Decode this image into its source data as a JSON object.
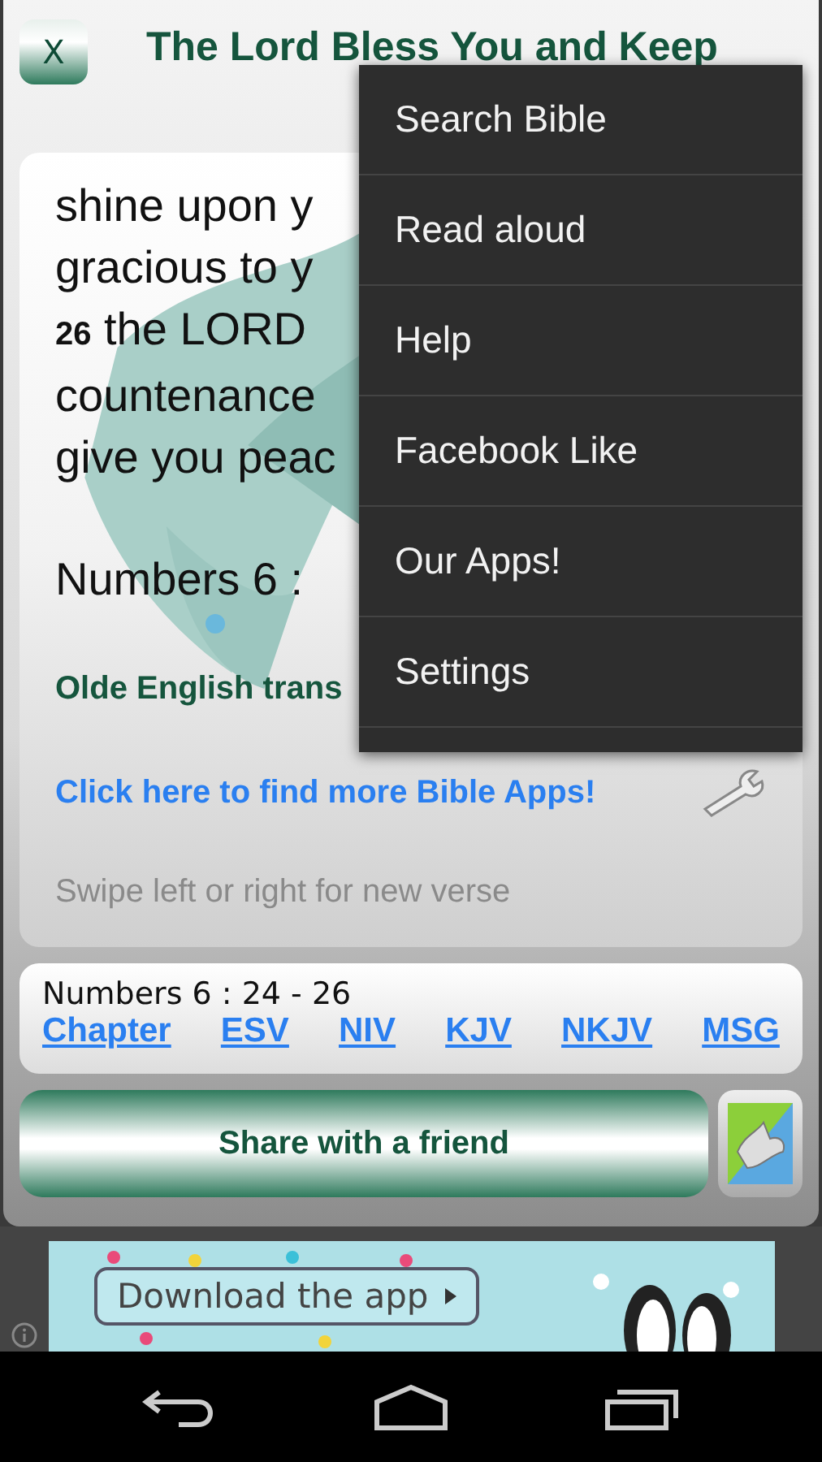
{
  "header": {
    "close_label": "X",
    "title": "The Lord Bless You and Keep"
  },
  "verse": {
    "lines": [
      "shine upon y",
      "gracious to y",
      "**26** the LORD",
      "countenance",
      "give you peac"
    ],
    "reference": "Numbers 6 :",
    "translation_note": "Olde English trans",
    "more_apps_link": "Click here to find more Bible Apps!",
    "hint": "Swipe left or right for new verse"
  },
  "passage": {
    "reference": "Numbers 6 : 24 - 26",
    "links": [
      "Chapter",
      "ESV",
      "NIV",
      "KJV",
      "NKJV",
      "MSG"
    ]
  },
  "share_button": "Share with a friend",
  "ad": {
    "cta": "Download the app"
  },
  "menu": {
    "items": [
      "Search Bible",
      "Read aloud",
      "Help",
      "Facebook Like",
      "Our Apps!",
      "Settings"
    ]
  }
}
